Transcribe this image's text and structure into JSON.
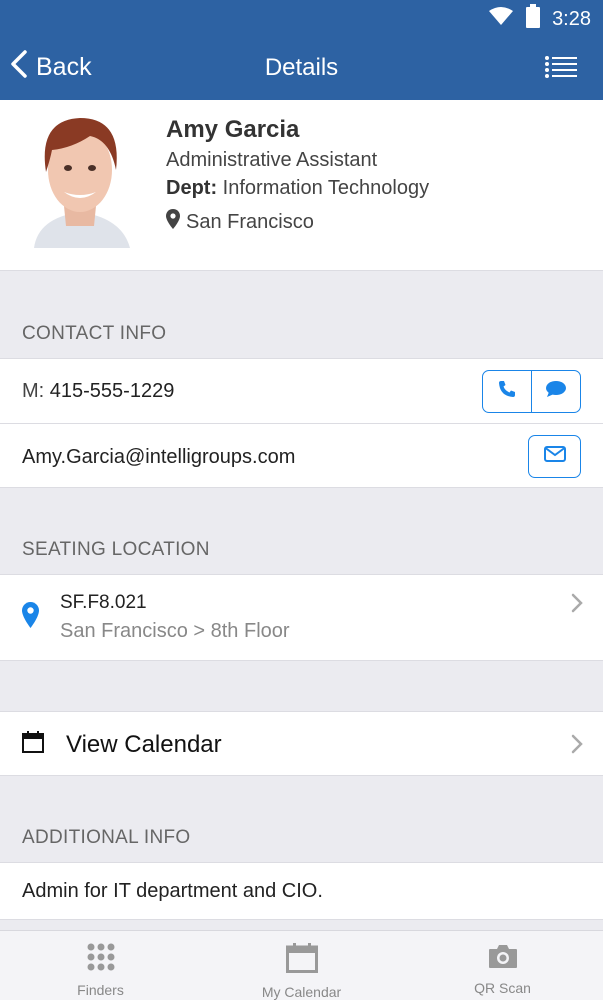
{
  "status_bar": {
    "time": "3:28",
    "icons": [
      "wifi-icon",
      "battery-icon"
    ]
  },
  "nav": {
    "back_label": "Back",
    "title": "Details",
    "menu_icon": "list-menu-icon"
  },
  "profile": {
    "name": "Amy Garcia",
    "title": "Administrative Assistant",
    "dept_label": "Dept:",
    "dept_value": "Information Technology",
    "location": "San Francisco"
  },
  "contact": {
    "header": "CONTACT INFO",
    "mobile_label": "M:",
    "mobile_value": "415-555-1229",
    "email": "Amy.Garcia@intelligroups.com"
  },
  "seating": {
    "header": "SEATING LOCATION",
    "code": "SF.F8.021",
    "path": "San Francisco > 8th Floor"
  },
  "calendar": {
    "label": "View Calendar"
  },
  "additional": {
    "header": "ADDITIONAL INFO",
    "text": "Admin for IT department and CIO."
  },
  "tabs": [
    {
      "label": "Finders",
      "icon": "grid-dots-icon"
    },
    {
      "label": "My Calendar",
      "icon": "calendar-icon"
    },
    {
      "label": "QR Scan",
      "icon": "camera-icon"
    }
  ],
  "colors": {
    "header_bg": "#2d62a3",
    "accent": "#1a85e8",
    "page_bg": "#ebebf0"
  }
}
